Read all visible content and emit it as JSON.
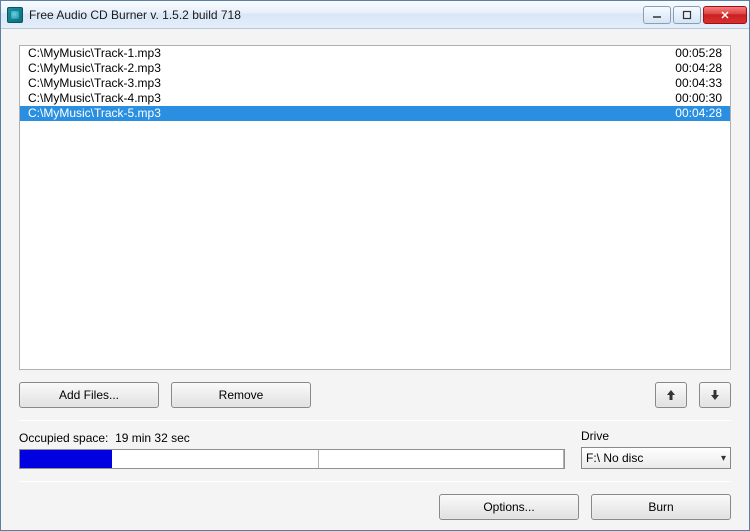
{
  "window": {
    "title": "Free Audio CD Burner  v. 1.5.2 build 718"
  },
  "tracks": [
    {
      "path": "C:\\MyMusic\\Track-1.mp3",
      "duration": "00:05:28",
      "selected": false
    },
    {
      "path": "C:\\MyMusic\\Track-2.mp3",
      "duration": "00:04:28",
      "selected": false
    },
    {
      "path": "C:\\MyMusic\\Track-3.mp3",
      "duration": "00:04:33",
      "selected": false
    },
    {
      "path": "C:\\MyMusic\\Track-4.mp3",
      "duration": "00:00:30",
      "selected": false
    },
    {
      "path": "C:\\MyMusic\\Track-5.mp3",
      "duration": "00:04:28",
      "selected": true
    }
  ],
  "buttons": {
    "add_files": "Add Files...",
    "remove": "Remove",
    "options": "Options...",
    "burn": "Burn"
  },
  "occupied": {
    "label_prefix": "Occupied space:",
    "value": "19 min 32 sec",
    "fill_percent": 17,
    "segments": [
      55,
      100
    ]
  },
  "drive": {
    "label": "Drive",
    "selected": "F:\\ No disc"
  }
}
